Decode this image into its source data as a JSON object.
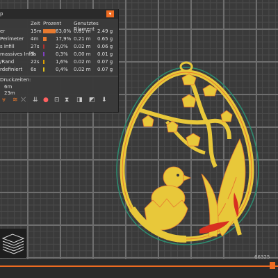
{
  "panel": {
    "title": "p",
    "columns": {
      "time": "Zeit",
      "percent": "Prozent",
      "filament": "Genutztes Filament"
    },
    "rows": [
      {
        "name": "er",
        "time": "15m",
        "percent": "63,0%",
        "length": "0.81 m",
        "weight": "2.49 g",
        "bar": 0.63,
        "color": "#e87a2f"
      },
      {
        "name": "Perimeter",
        "time": "4m",
        "percent": "17,9%",
        "length": "0.21 m",
        "weight": "0.65 g",
        "bar": 0.179,
        "color": "#e87a2f"
      },
      {
        "name": "s Infill",
        "time": "27s",
        "percent": "2,0%",
        "length": "0.02 m",
        "weight": "0.06 g",
        "bar": 0.02,
        "color": "#b03030"
      },
      {
        "name": "massives Infill",
        "time": "5s",
        "percent": "0,3%",
        "length": "0.00 m",
        "weight": "0.01 g",
        "bar": 0.003,
        "color": "#8040c0"
      },
      {
        "name": "/Rand",
        "time": "22s",
        "percent": "1,6%",
        "length": "0.02 m",
        "weight": "0.07 g",
        "bar": 0.016,
        "color": "#e0a000"
      },
      {
        "name": "rdefiniert",
        "time": "6s",
        "percent": "0,4%",
        "length": "0.02 m",
        "weight": "0.07 g",
        "bar": 0.004,
        "color": "#e0c020"
      }
    ],
    "print_times_label": "Druckzeiten:",
    "times": [
      "6m",
      "23m"
    ]
  },
  "toolbar_icons": [
    "layers-icon",
    "tool-marker-icon",
    "retract-icon",
    "color-icon",
    "seam-icon",
    "hourglass-icon",
    "shells-icon",
    "legend-icon",
    "export-icon"
  ],
  "layer_number": "66325",
  "colors": {
    "accent": "#ed6b21",
    "model": "#e8c83a",
    "outline": "#2e8a6e",
    "inner_outline": "#e87a2f"
  }
}
